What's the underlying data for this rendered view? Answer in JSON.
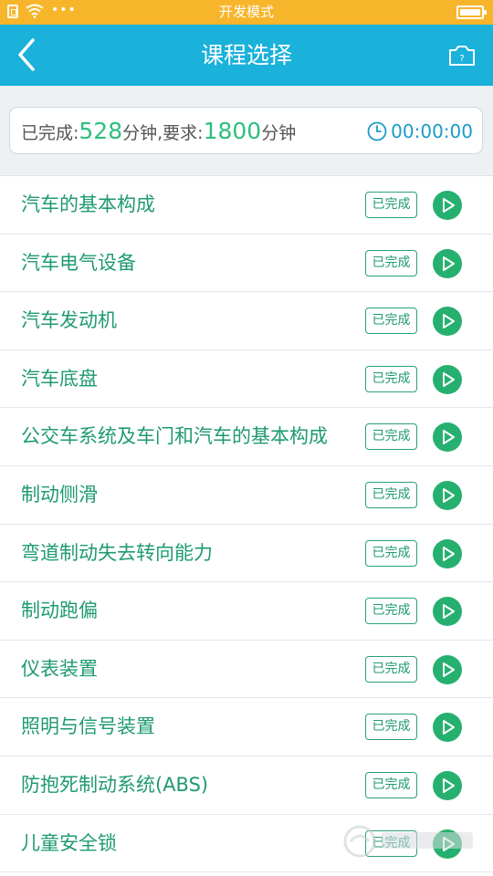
{
  "status_bar": {
    "center_text": "开发模式",
    "icons": [
      "sim-icon",
      "wifi-icon",
      "more-dots-icon",
      "battery-icon"
    ]
  },
  "nav": {
    "title": "课程选择",
    "back_icon": "chevron-left-icon",
    "camera_icon": "camera-icon"
  },
  "progress": {
    "completed_label": "已完成:",
    "completed_value": "528",
    "completed_unit": "分钟,要求:",
    "required_value": "1800",
    "required_unit": "分钟",
    "timer": "00:00:00"
  },
  "courses": [
    {
      "name": "汽车的基本构成",
      "status": "已完成"
    },
    {
      "name": "汽车电气设备",
      "status": "已完成"
    },
    {
      "name": "汽车发动机",
      "status": "已完成"
    },
    {
      "name": "汽车底盘",
      "status": "已完成"
    },
    {
      "name": "公交车系统及车门和汽车的基本构成",
      "status": "已完成"
    },
    {
      "name": "制动侧滑",
      "status": "已完成"
    },
    {
      "name": "弯道制动失去转向能力",
      "status": "已完成"
    },
    {
      "name": "制动跑偏",
      "status": "已完成"
    },
    {
      "name": "仪表装置",
      "status": "已完成"
    },
    {
      "name": "照明与信号装置",
      "status": "已完成"
    },
    {
      "name": "防抱死制动系统(ABS)",
      "status": "已完成"
    },
    {
      "name": "儿童安全锁",
      "status": "已完成"
    }
  ],
  "colors": {
    "status_bar": "#f7b52b",
    "nav_bar": "#1ab1db",
    "accent_green": "#26b06f",
    "text_green": "#1f9a71",
    "timer_blue": "#1a9cc8"
  }
}
